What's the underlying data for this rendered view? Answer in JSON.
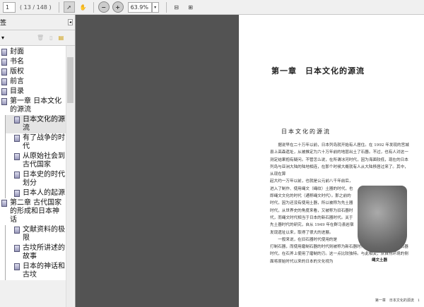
{
  "toolbar": {
    "page_input": "1",
    "page_count": "( 13 / 148 )",
    "zoom": "63.9%"
  },
  "panel": {
    "title": "签",
    "collapse": "◂"
  },
  "bookmarks": [
    {
      "label": "封面",
      "level": 0
    },
    {
      "label": "书名",
      "level": 0
    },
    {
      "label": "版权",
      "level": 0
    },
    {
      "label": "前言",
      "level": 0
    },
    {
      "label": "目录",
      "level": 0
    },
    {
      "label": "第一章 日本文化的源流",
      "level": 0
    },
    {
      "label": "日本文化的源流",
      "level": 1,
      "selected": true
    },
    {
      "label": "有了战争的时代",
      "level": 1
    },
    {
      "label": "从原始社会到古代国家",
      "level": 1
    },
    {
      "label": "日本史的时代划分",
      "level": 1
    },
    {
      "label": "日本人的起源",
      "level": 1
    },
    {
      "label": "第二章 古代国家的形成和日本神话",
      "level": 0
    },
    {
      "label": "文献资料的极限",
      "level": 1
    },
    {
      "label": "古坟所讲述的故事",
      "level": 1
    },
    {
      "label": "日本的神话和古坟",
      "level": 1
    }
  ],
  "document": {
    "chapter_title": "第一章　日本文化的源流",
    "section_title": "日本文化的源流",
    "para1_full": "据说早在二十万年以前，日本列岛就开始有人居住。在 1992 年发现的宫城县上高森遗址，从被推定为六十万年前的地层出土了石器。不过，也有人对这一测定结果抱有疑问。不管怎么说，在所谓冰河时代，因为海面较低，现在的日本列岛与亚洲大陆的陆地相连，在那个时候大概就有人从大陆移居过来了。其中，从现在算",
    "para1_narrow": "起大约一万年以前，也就是公元前八千年前后，进入了制作、使用绳文（绳纹）土器的时代，也即绳文文化的时代（通称绳文时代）。那之前的时代，因为还没有使用土器，所以被称为先土器时代，从世界史的角度来看，又被称为旧石器时代，而绳文时代相当于日本的新石器时代。关于先土器时代的研究，自从 1949 年在群马县岩宿发现遗址以来，取得了很大的进展。",
    "para2_narrow": "一般来说，在旧石器时代使用的是",
    "para2_full": "打制石器，而使用磨制石器的时代则被称为新石器时代。不过，在日本的旧石器时代，在石斧上使用了磨制的刃。这一点比较独特。与此相关，从自然环境的侧面将原始时代以来的日本的文化视为",
    "image_caption": "绳文土器",
    "footer": "第一章　日本文化的源流　1"
  }
}
